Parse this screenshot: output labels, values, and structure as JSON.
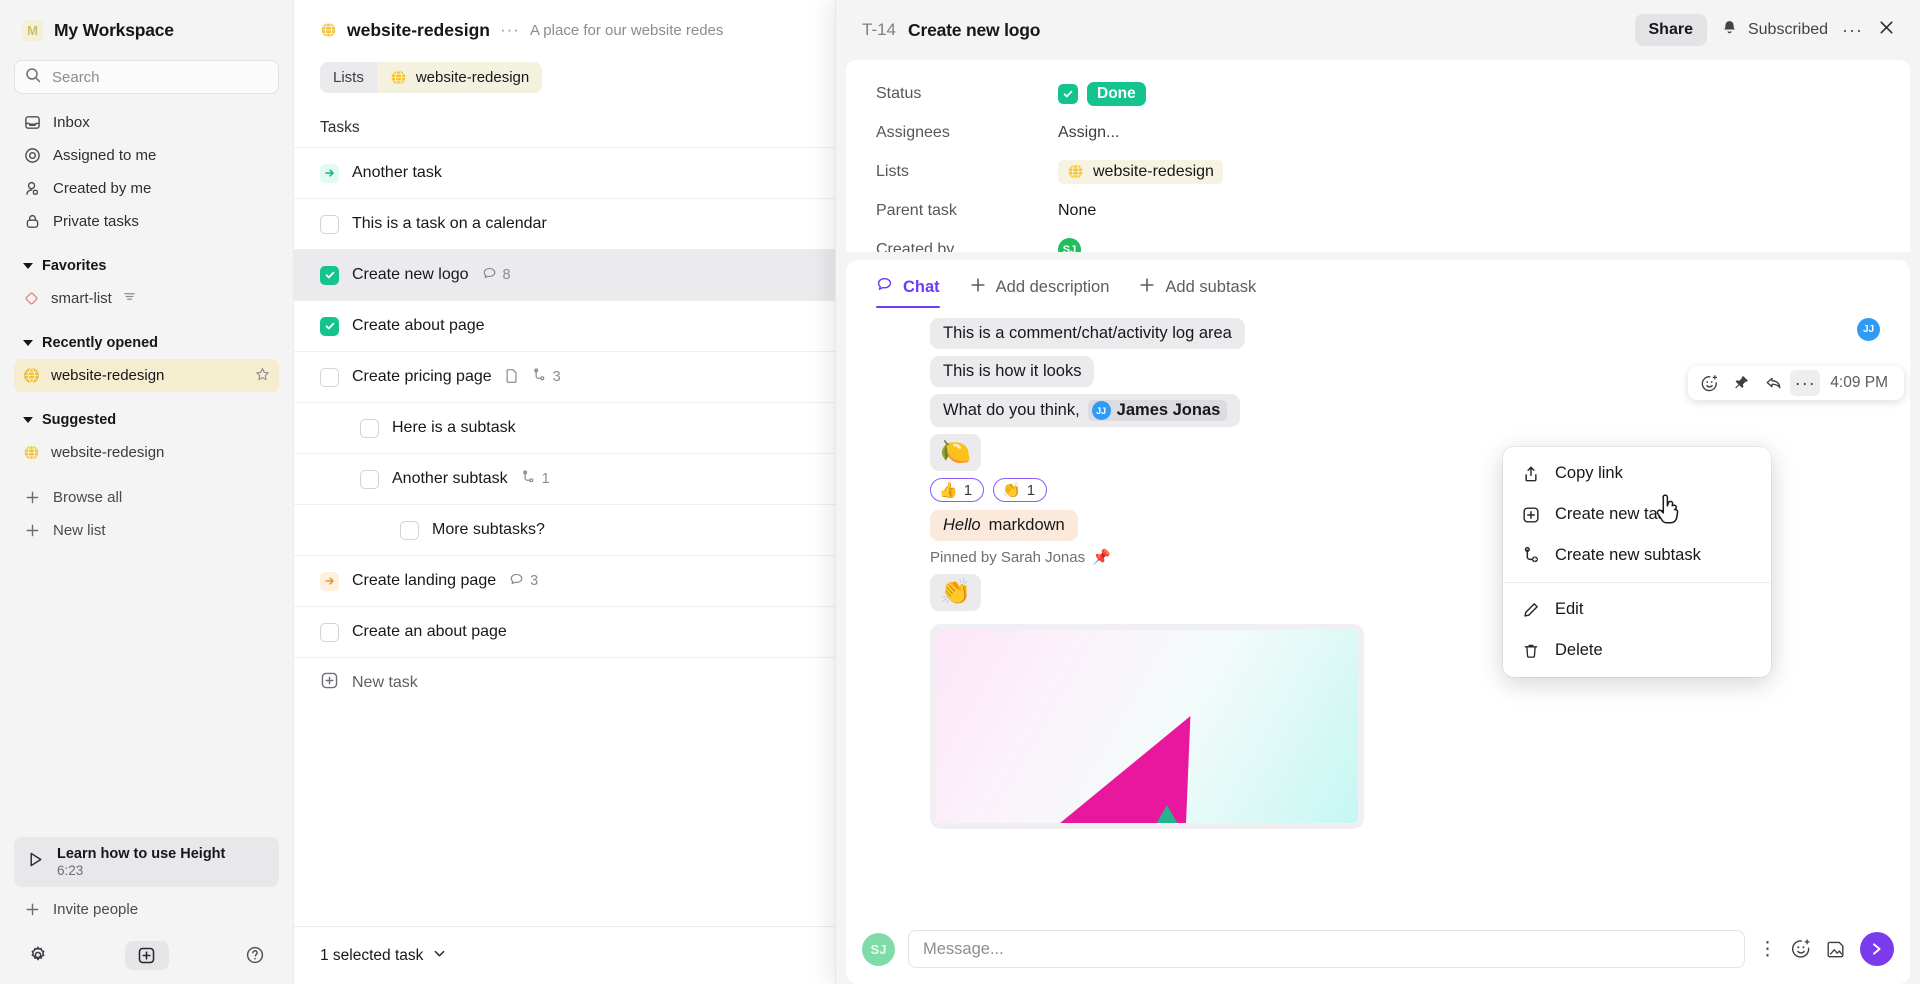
{
  "sidebar": {
    "workspace": {
      "initial": "M",
      "name": "My Workspace"
    },
    "search": {
      "placeholder": "Search",
      "label": "Search"
    },
    "nav": [
      {
        "label": "Inbox",
        "icon": "inbox-icon"
      },
      {
        "label": "Assigned to me",
        "icon": "target-icon"
      },
      {
        "label": "Created by me",
        "icon": "person-icon"
      },
      {
        "label": "Private tasks",
        "icon": "lock-icon"
      }
    ],
    "sections": [
      {
        "title": "Favorites",
        "items": [
          {
            "label": "smart-list",
            "icon": "diamond-icon",
            "suffix": "filter-icon"
          }
        ]
      },
      {
        "title": "Recently opened",
        "items": [
          {
            "label": "website-redesign",
            "icon": "globe-icon",
            "active": true,
            "star": true
          }
        ]
      },
      {
        "title": "Suggested",
        "items": [
          {
            "label": "website-redesign",
            "icon": "globe-icon"
          }
        ]
      }
    ],
    "actions": [
      {
        "label": "Browse all",
        "icon": "plus-icon"
      },
      {
        "label": "New list",
        "icon": "plus-icon"
      }
    ],
    "learn_card": {
      "title": "Learn how to use Height",
      "duration": "6:23",
      "icon": "play-icon"
    },
    "invite": {
      "label": "Invite people",
      "icon": "plus-icon"
    },
    "footer": {
      "settings": "gear-icon",
      "add": "plus-square-icon",
      "help": "question-icon"
    }
  },
  "list_panel": {
    "title": "website-redesign",
    "more": "···",
    "description": "A place for our website redes",
    "breadcrumb": {
      "left": "Lists",
      "right": "website-redesign"
    },
    "tasks_label": "Tasks",
    "tasks": [
      {
        "title": "Another task",
        "state": "arrow-green",
        "indent": 0,
        "selected": false,
        "meta": []
      },
      {
        "title": "This is a task on a calendar",
        "state": "open",
        "indent": 0,
        "selected": false,
        "meta": []
      },
      {
        "title": "Create new logo",
        "state": "done",
        "indent": 0,
        "selected": true,
        "meta": [
          {
            "icon": "comment-icon",
            "value": "8"
          }
        ]
      },
      {
        "title": "Create about page",
        "state": "done",
        "indent": 0,
        "selected": false,
        "meta": []
      },
      {
        "title": "Create pricing page",
        "state": "open",
        "indent": 0,
        "selected": false,
        "meta": [
          {
            "icon": "document-icon",
            "value": ""
          },
          {
            "icon": "subtask-icon",
            "value": "3"
          }
        ]
      },
      {
        "title": "Here is a subtask",
        "state": "open",
        "indent": 1,
        "selected": false,
        "meta": []
      },
      {
        "title": "Another subtask",
        "state": "open",
        "indent": 1,
        "selected": false,
        "meta": [
          {
            "icon": "subtask-icon",
            "value": "1"
          }
        ]
      },
      {
        "title": "More subtasks?",
        "state": "open",
        "indent": 2,
        "selected": false,
        "meta": []
      },
      {
        "title": "Create landing page",
        "state": "arrow-amber",
        "indent": 0,
        "selected": false,
        "meta": [
          {
            "icon": "comment-icon",
            "value": "3"
          }
        ]
      },
      {
        "title": "Create an about page",
        "state": "open",
        "indent": 0,
        "selected": false,
        "meta": []
      }
    ],
    "new_task": "New task",
    "footer_status": "1 selected task"
  },
  "detail": {
    "task_id": "T-14",
    "task_title": "Create new logo",
    "share_label": "Share",
    "subscribed_label": "Subscribed",
    "more_label": "···",
    "close_label": "✕",
    "properties": [
      {
        "key": "Status",
        "value": "Done",
        "type": "status"
      },
      {
        "key": "Assignees",
        "value": "Assign...",
        "type": "text"
      },
      {
        "key": "Lists",
        "value": "website-redesign",
        "type": "list-chip"
      },
      {
        "key": "Parent task",
        "value": "None",
        "type": "text"
      },
      {
        "key": "Created by",
        "value": "SJ",
        "type": "avatar"
      }
    ],
    "tabs": [
      {
        "label": "Chat",
        "icon": "chat-icon",
        "active": true
      },
      {
        "label": "Add description",
        "icon": "plus-icon",
        "active": false
      },
      {
        "label": "Add subtask",
        "icon": "plus-icon",
        "active": false
      }
    ],
    "messages": [
      {
        "type": "text",
        "text": "This is a comment/chat/activity log area"
      },
      {
        "type": "text",
        "text": "This is how it looks"
      },
      {
        "type": "mention",
        "text": "What do you think,",
        "mention_initials": "JJ",
        "mention_name": "James Jonas"
      },
      {
        "type": "emoji",
        "text": "🍋"
      },
      {
        "type": "reactions",
        "reactions": [
          {
            "emoji": "👍",
            "count": "1"
          },
          {
            "emoji": "👏",
            "count": "1"
          }
        ]
      },
      {
        "type": "markdown",
        "italic": "Hello",
        "rest": " markdown",
        "pinned_by": "Pinned by Sarah Jonas",
        "pin_icon": "📌"
      },
      {
        "type": "emoji",
        "text": "👏"
      },
      {
        "type": "attachment",
        "alt": "colorful abstract image attachment"
      }
    ],
    "thread_avatar": "JJ",
    "msg_toolbar": {
      "emoji_icon": "add-reaction-icon",
      "pin_icon": "pin-icon",
      "reply_icon": "reply-icon",
      "more_icon": "···",
      "time": "4:09 PM"
    },
    "context_menu": [
      {
        "label": "Copy link",
        "icon": "share-icon"
      },
      {
        "label": "Create new task",
        "icon": "plus-square-icon"
      },
      {
        "label": "Create new subtask",
        "icon": "subtask-plus-icon"
      },
      {
        "separator": true
      },
      {
        "label": "Edit",
        "icon": "pencil-icon"
      },
      {
        "label": "Delete",
        "icon": "trash-icon"
      }
    ],
    "composer": {
      "avatar": "SJ",
      "placeholder": "Message...",
      "value": "",
      "more_icon": "more-vertical-icon",
      "emoji_icon": "add-reaction-icon",
      "attach_icon": "attachment-icon",
      "send_icon": "send-icon"
    }
  },
  "colors": {
    "accent": "#6b3df5",
    "done": "#14c38e",
    "highlight": "#f4edcf",
    "send": "#7c3aed"
  }
}
